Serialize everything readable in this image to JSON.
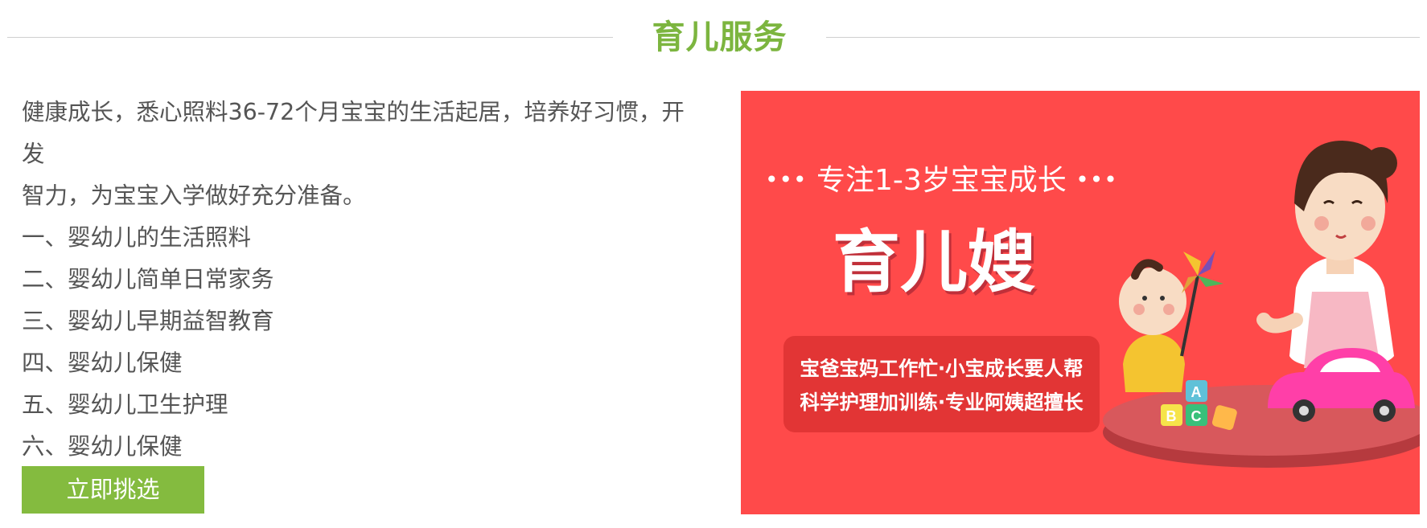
{
  "section": {
    "title": "育儿服务"
  },
  "description": {
    "intro_line1": "健康成长，悉心照料36-72个月宝宝的生活起居，培养好习惯，开发",
    "intro_line2": "智力，为宝宝入学做好充分准备。",
    "items": [
      "一、婴幼儿的生活照料",
      "二、婴幼儿简单日常家务",
      "三、婴幼儿早期益智教育",
      "四、婴幼儿保健",
      "五、婴幼儿卫生护理",
      "六、婴幼儿保健"
    ]
  },
  "cta": {
    "label": "立即挑选"
  },
  "banner": {
    "dots": "•••",
    "tagline": "专注1-3岁宝宝成长",
    "title": "育儿嫂",
    "slogan_line1": "宝爸宝妈工作忙·小宝成长要人帮",
    "slogan_line2": "科学护理加训练·专业阿姨超擅长",
    "blocks": [
      "A",
      "B",
      "C"
    ]
  },
  "colors": {
    "accent_green": "#84bb3f",
    "title_green": "#7cb53f",
    "banner_red": "#ff4a4a",
    "text_gray": "#555555"
  }
}
